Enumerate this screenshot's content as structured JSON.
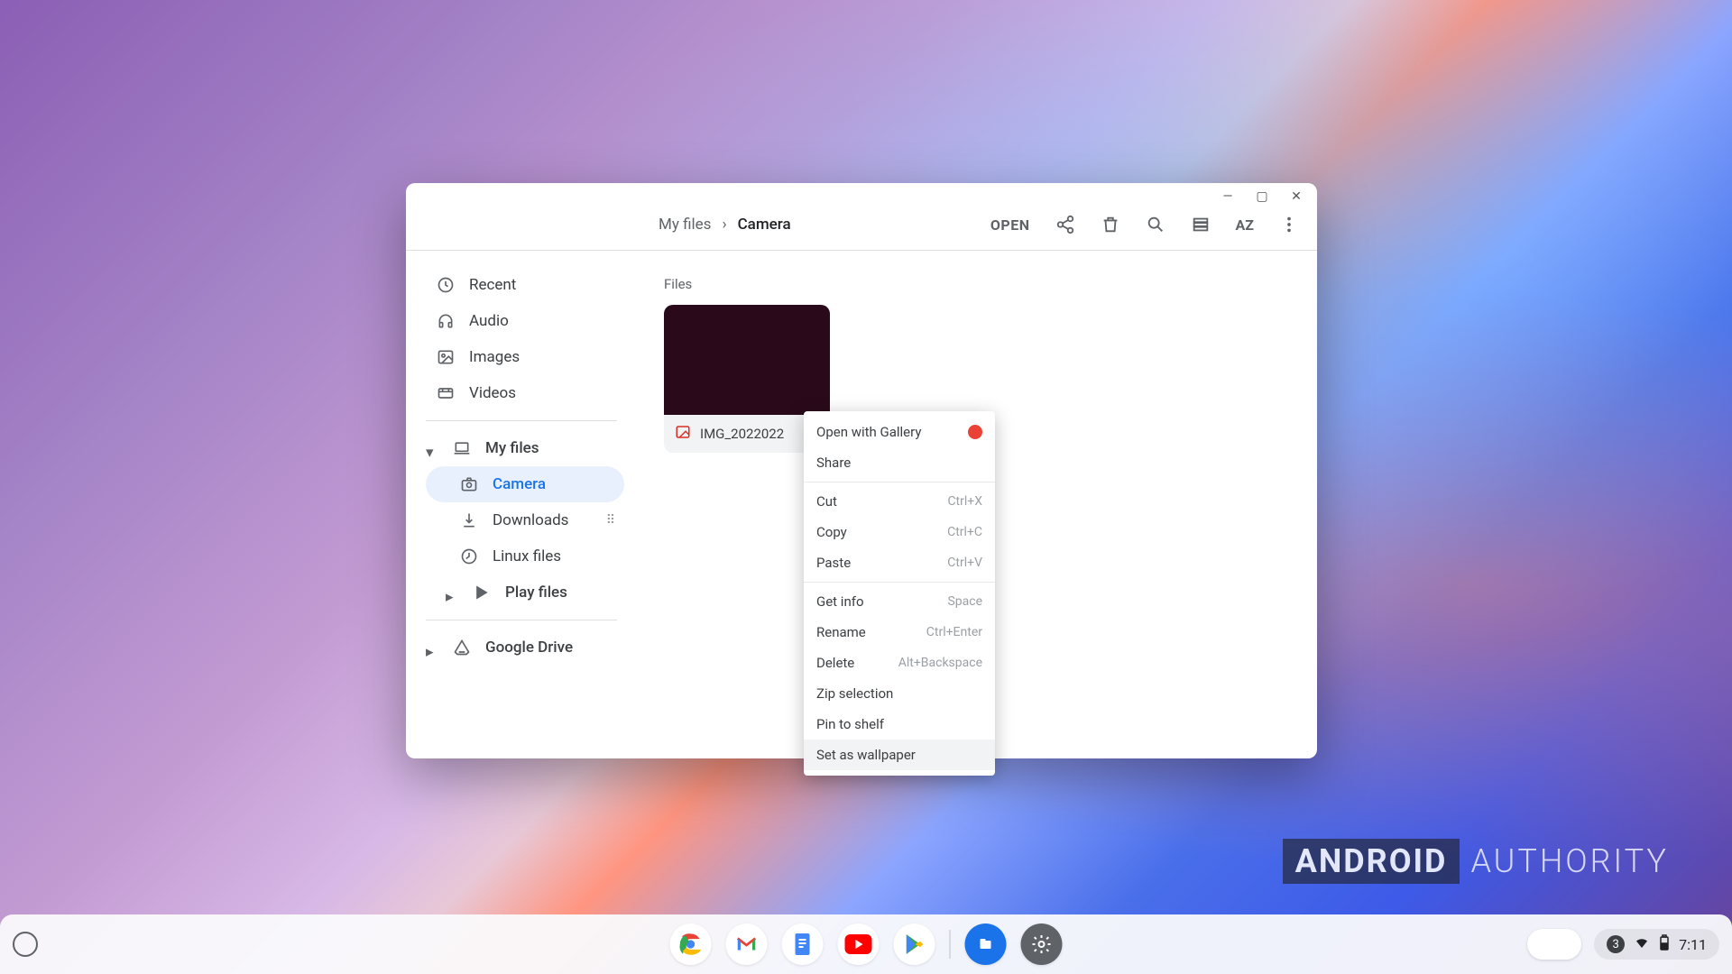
{
  "window": {
    "controls": {
      "min": "—",
      "max": "▢",
      "close": "✕"
    },
    "breadcrumb": {
      "root": "My files",
      "current": "Camera"
    },
    "toolbar": {
      "open": "OPEN",
      "sort": "AZ"
    },
    "sidebar": {
      "top": [
        {
          "label": "Recent",
          "icon": "clock"
        },
        {
          "label": "Audio",
          "icon": "headphones"
        },
        {
          "label": "Images",
          "icon": "image"
        },
        {
          "label": "Videos",
          "icon": "video"
        }
      ],
      "myfiles": {
        "label": "My files"
      },
      "children": [
        {
          "label": "Camera",
          "selected": true
        },
        {
          "label": "Downloads",
          "drag": true
        },
        {
          "label": "Linux files"
        },
        {
          "label": "Play files",
          "expandable": true
        }
      ],
      "drive": {
        "label": "Google Drive"
      }
    },
    "content": {
      "section": "Files",
      "file": {
        "name": "IMG_2022022"
      }
    }
  },
  "context_menu": {
    "groups": [
      [
        {
          "label": "Open with Gallery",
          "badge": "gallery"
        },
        {
          "label": "Share"
        }
      ],
      [
        {
          "label": "Cut",
          "shortcut": "Ctrl+X"
        },
        {
          "label": "Copy",
          "shortcut": "Ctrl+C"
        },
        {
          "label": "Paste",
          "shortcut": "Ctrl+V"
        }
      ],
      [
        {
          "label": "Get info",
          "shortcut": "Space"
        },
        {
          "label": "Rename",
          "shortcut": "Ctrl+Enter"
        },
        {
          "label": "Delete",
          "shortcut": "Alt+Backspace"
        },
        {
          "label": "Zip selection"
        },
        {
          "label": "Pin to shelf"
        },
        {
          "label": "Set as wallpaper",
          "selected": true
        }
      ]
    ]
  },
  "shelf": {
    "apps": [
      "chrome",
      "gmail",
      "docs",
      "youtube",
      "play",
      "files",
      "settings"
    ],
    "tray": {
      "notif": "3",
      "time": "7:11"
    }
  },
  "watermark": {
    "bold": "ANDROID",
    "light": "AUTHORITY"
  }
}
